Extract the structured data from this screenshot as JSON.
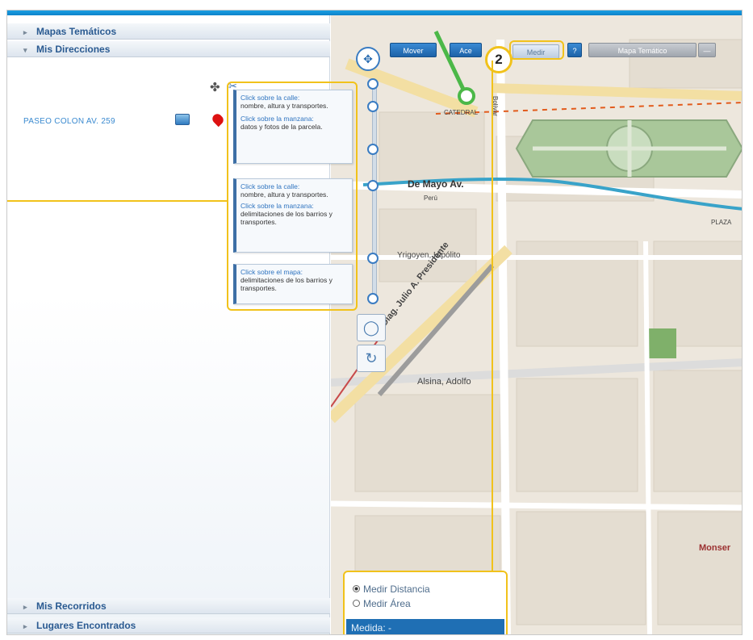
{
  "left_panel": {
    "sections": {
      "mapas_tematicos": "Mapas Temáticos",
      "mis_direcciones": "Mis Direcciones",
      "mis_recorridos": "Mis Recorridos",
      "lugares_encontrados": "Lugares Encontrados"
    },
    "address": "PASEO COLON AV. 259"
  },
  "tooltips": [
    {
      "blue": "Click sobre la calle:",
      "text": "nombre, altura y transportes.",
      "blue2": "Click sobre la manzana:",
      "text2": "datos y fotos de la parcela."
    },
    {
      "blue": "Click sobre la calle:",
      "text": "nombre, altura y transportes.",
      "blue2": "Click sobre la manzana:",
      "text2": "delimitaciones de los barrios y transportes."
    },
    {
      "blue": "Click sobre el mapa:",
      "text": "delimitaciones de los barrios y transportes."
    }
  ],
  "toolbar": {
    "mover": "Mover",
    "acercar": "Ace",
    "medir": "Medir",
    "info": "?",
    "mapa_tematico": "Mapa Temático",
    "dropdown": "—"
  },
  "callout_number": "2",
  "map_labels": {
    "catedral": "CATEDRAL",
    "de_mayo": "De Mayo Av.",
    "peru": "Perú",
    "yrigoyen": "Yrigoyen, Hipólito",
    "julio_roca": "Diag. Julio A. Presidente",
    "alsina": "Alsina, Adolfo",
    "bolivar": "Bolívar",
    "plaza": "PLAZA",
    "monserrat": "Monser"
  },
  "measure_panel": {
    "option_distance": "Medir Distancia",
    "option_area": "Medir Área",
    "result": "Medida: -"
  },
  "colors": {
    "accent": "#1f6fb4",
    "highlight": "#f1c21b",
    "map_bg": "#ede7dd"
  }
}
